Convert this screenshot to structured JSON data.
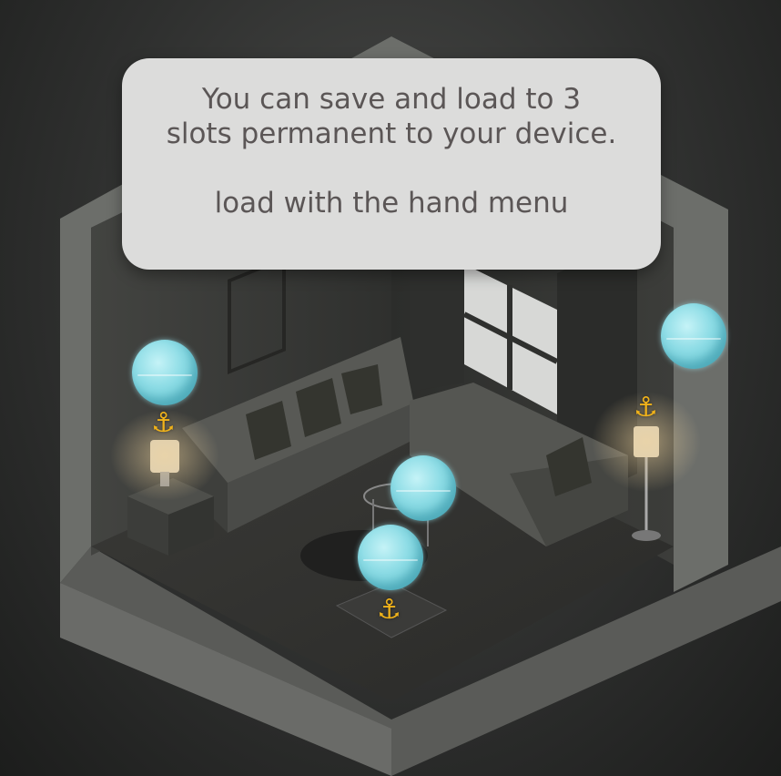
{
  "tooltip": {
    "line1": "You can save and load to 3",
    "line2": "slots permanent to your device.",
    "line3": "load with the hand menu"
  },
  "icons": {
    "anchor": "⚓"
  },
  "colors": {
    "tooltip_bg": "#dcdcdb",
    "tooltip_text": "#5b5656",
    "orb": "#8fdde6",
    "anchor": "#f0b21a"
  }
}
